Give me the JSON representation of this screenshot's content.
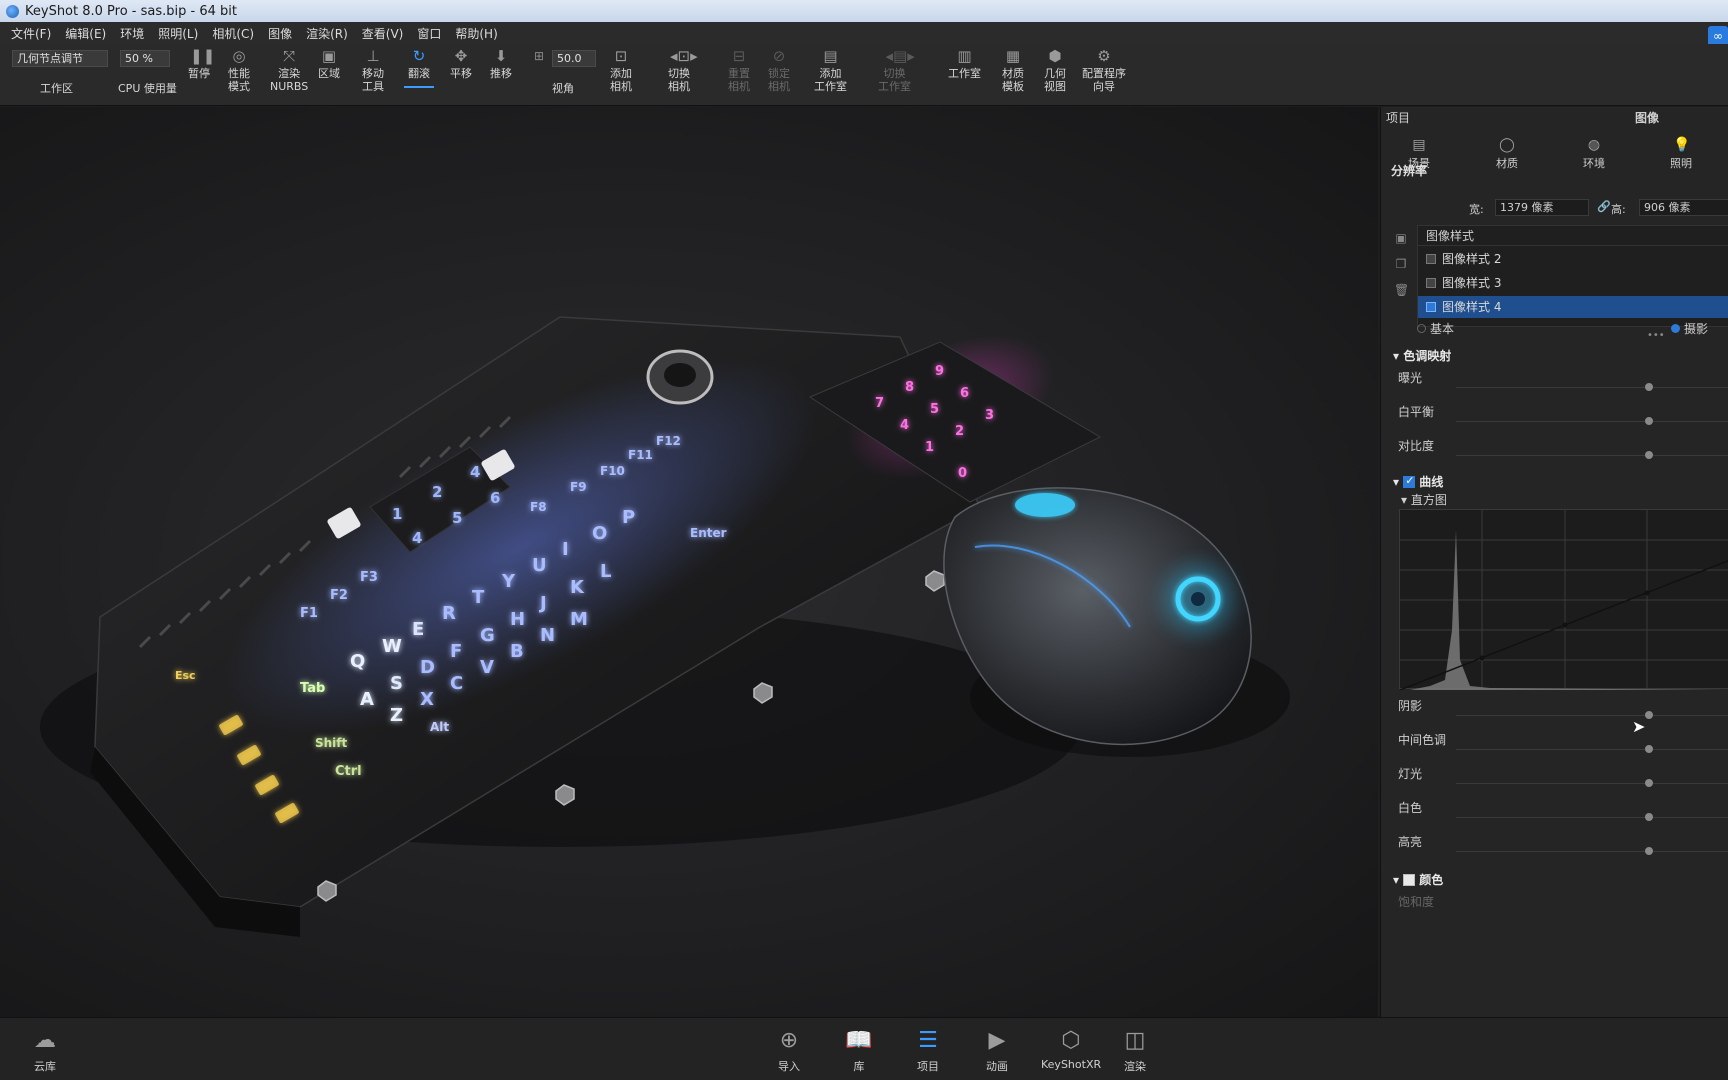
{
  "window": {
    "title": "KeyShot 8.0 Pro  - sas.bip  - 64 bit"
  },
  "menu": [
    "文件(F)",
    "编辑(E)",
    "环境",
    "照明(L)",
    "相机(C)",
    "图像",
    "渲染(R)",
    "查看(V)",
    "窗口",
    "帮助(H)"
  ],
  "toolbar": {
    "workspace_value": "几何节点调节",
    "workspace_label": "工作区",
    "cpu_value": "50 %",
    "cpu_label": "CPU  使用量",
    "pause": "暂停",
    "performance_mode": "性能\n模式",
    "render_nurbs": "渲染\nNURBS",
    "region": "区域",
    "move_tool": "移动\n工具",
    "tumble": "翻滚",
    "pan": "平移",
    "dolly": "推移",
    "fov_value": "50.0",
    "fov_label": "视角",
    "add_camera": "添加\n相机",
    "switch_camera": "切换\n相机",
    "reset_camera": "重置\n相机",
    "lock_camera": "锁定\n相机",
    "add_studio": "添加\n工作室",
    "switch_studio": "切换\n工作室",
    "studio": "工作室",
    "material_template": "材质\n模板",
    "geometry_view": "几何\n视图",
    "config_wizard": "配置程序\n向导"
  },
  "panel": {
    "header_left": "项目",
    "header_right": "图像",
    "tabs": [
      {
        "label": "场景",
        "icon": "scene-icon"
      },
      {
        "label": "材质",
        "icon": "material-icon"
      },
      {
        "label": "环境",
        "icon": "environment-icon"
      },
      {
        "label": "照明",
        "icon": "lighting-icon"
      }
    ],
    "resolution_title": "分辨率",
    "width_label": "宽:",
    "width_value": "1379 像素",
    "height_label": "高:",
    "height_value": "906 像素",
    "image_styles_header": "图像样式",
    "image_styles": [
      "图像样式 2",
      "图像样式 3",
      "图像样式 4"
    ],
    "selected_style_index": 2,
    "mode_basic": "基本",
    "mode_photo": "摄影",
    "tone_mapping": "色调映射",
    "tone_sliders": [
      "曝光",
      "白平衡",
      "对比度"
    ],
    "curves": "曲线",
    "histogram": "直方图",
    "curve_sliders": [
      "阴影",
      "中间色调",
      "灯光",
      "白色",
      "高亮"
    ],
    "color": "颜色",
    "color_sub": "饱和度"
  },
  "bottom": {
    "cloud": "云库",
    "buttons": [
      "导入",
      "库",
      "项目",
      "动画",
      "KeyShotXR",
      "渲染"
    ],
    "active_index": 2
  },
  "scene": {
    "numpad_keys": [
      "1",
      "2",
      "4",
      "4",
      "5",
      "6"
    ],
    "main_keys": [
      "Esc",
      "F1",
      "F2",
      "F3",
      "F8",
      "F9",
      "F10",
      "F11",
      "F12",
      "Tab",
      "Q",
      "W",
      "E",
      "R",
      "T",
      "Y",
      "U",
      "I",
      "O",
      "P",
      "A",
      "S",
      "D",
      "F",
      "G",
      "H",
      "J",
      "K",
      "L",
      "Z",
      "X",
      "C",
      "V",
      "B",
      "N",
      "M",
      "Ctrl",
      "Alt",
      "Shift",
      "Enter"
    ],
    "pink_keys": [
      "7",
      "8",
      "9",
      "4",
      "5",
      "6",
      "1",
      "2",
      "3",
      "0"
    ]
  },
  "colors": {
    "accent": "#3d9bff",
    "selection": "#1f4f8f",
    "blue_glow": "#5a7dff",
    "pink_glow": "#ff3fd8",
    "yellow_glow": "#e8c24a"
  }
}
